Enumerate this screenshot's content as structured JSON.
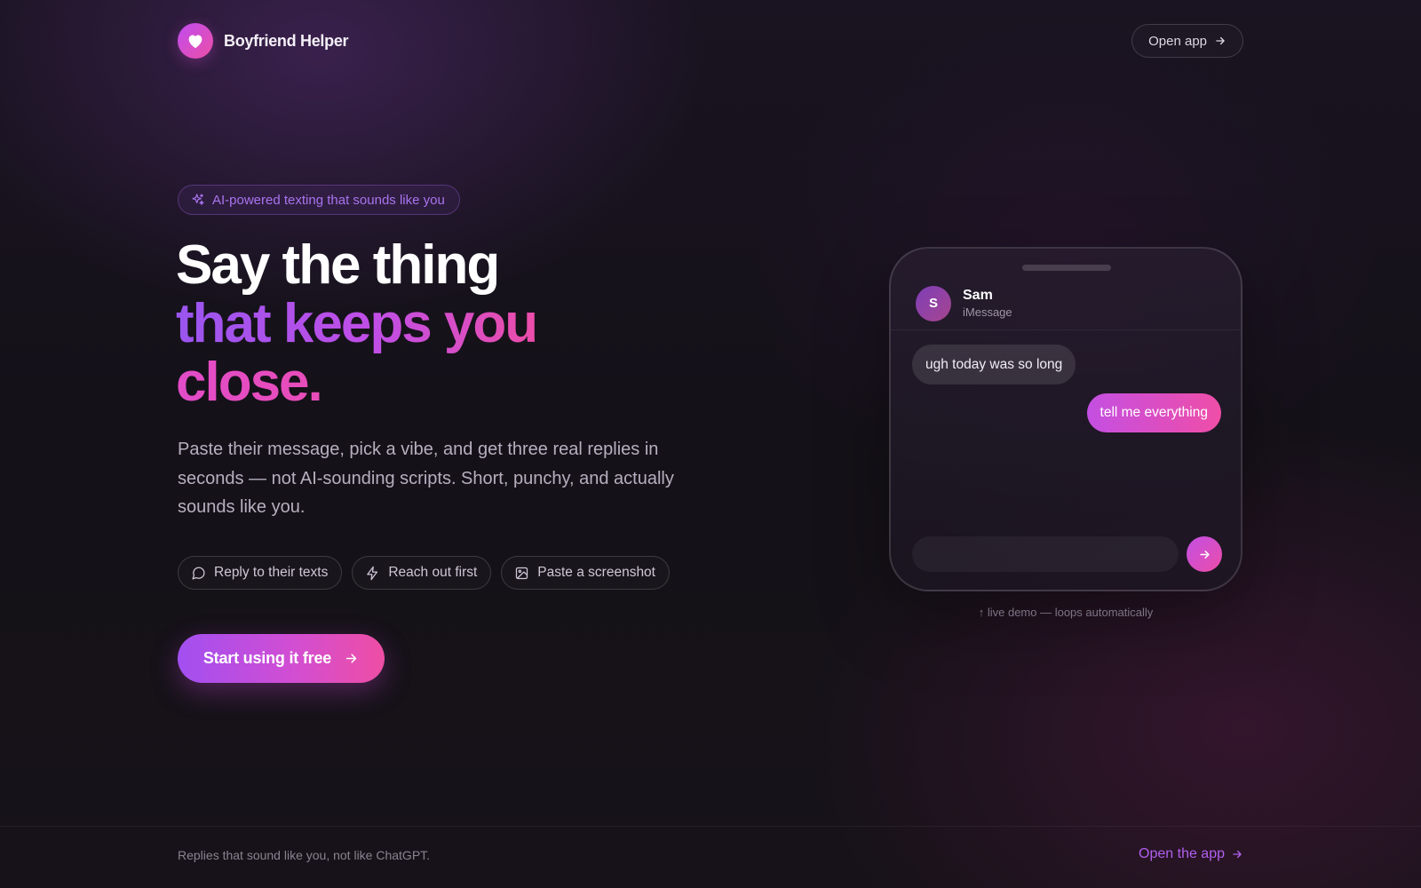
{
  "brand": {
    "name": "Boyfriend Helper",
    "logo_icon": "heart-icon"
  },
  "header": {
    "open_app_label": "Open app"
  },
  "hero": {
    "badge": "AI-powered texting that sounds like you",
    "headline": {
      "line1": "Say the thing",
      "line2": "that keeps you",
      "line3": "close."
    },
    "description": "Paste their message, pick a vibe, and get three real replies in seconds — not AI-sounding scripts. Short, punchy, and actually sounds like you.",
    "chips": [
      {
        "label": "Reply to their texts",
        "icon": "message-bubble-icon"
      },
      {
        "label": "Reach out first",
        "icon": "lightning-icon"
      },
      {
        "label": "Paste a screenshot",
        "icon": "image-icon"
      }
    ],
    "cta_label": "Start using it free"
  },
  "demo": {
    "contact": {
      "initial": "S",
      "name": "Sam",
      "app": "iMessage"
    },
    "messages": [
      {
        "direction": "incoming",
        "text": "ugh today was so long"
      },
      {
        "direction": "outgoing",
        "text": "tell me everything"
      }
    ],
    "input_value": "",
    "caption": "↑ live demo — loops automatically"
  },
  "footer": {
    "tagline": "Replies that sound like you, not like ChatGPT.",
    "link_label": "Open the app"
  },
  "colors": {
    "accent_purple": "#a24ff0",
    "accent_pink": "#ee4ea4",
    "background": "#151118"
  }
}
